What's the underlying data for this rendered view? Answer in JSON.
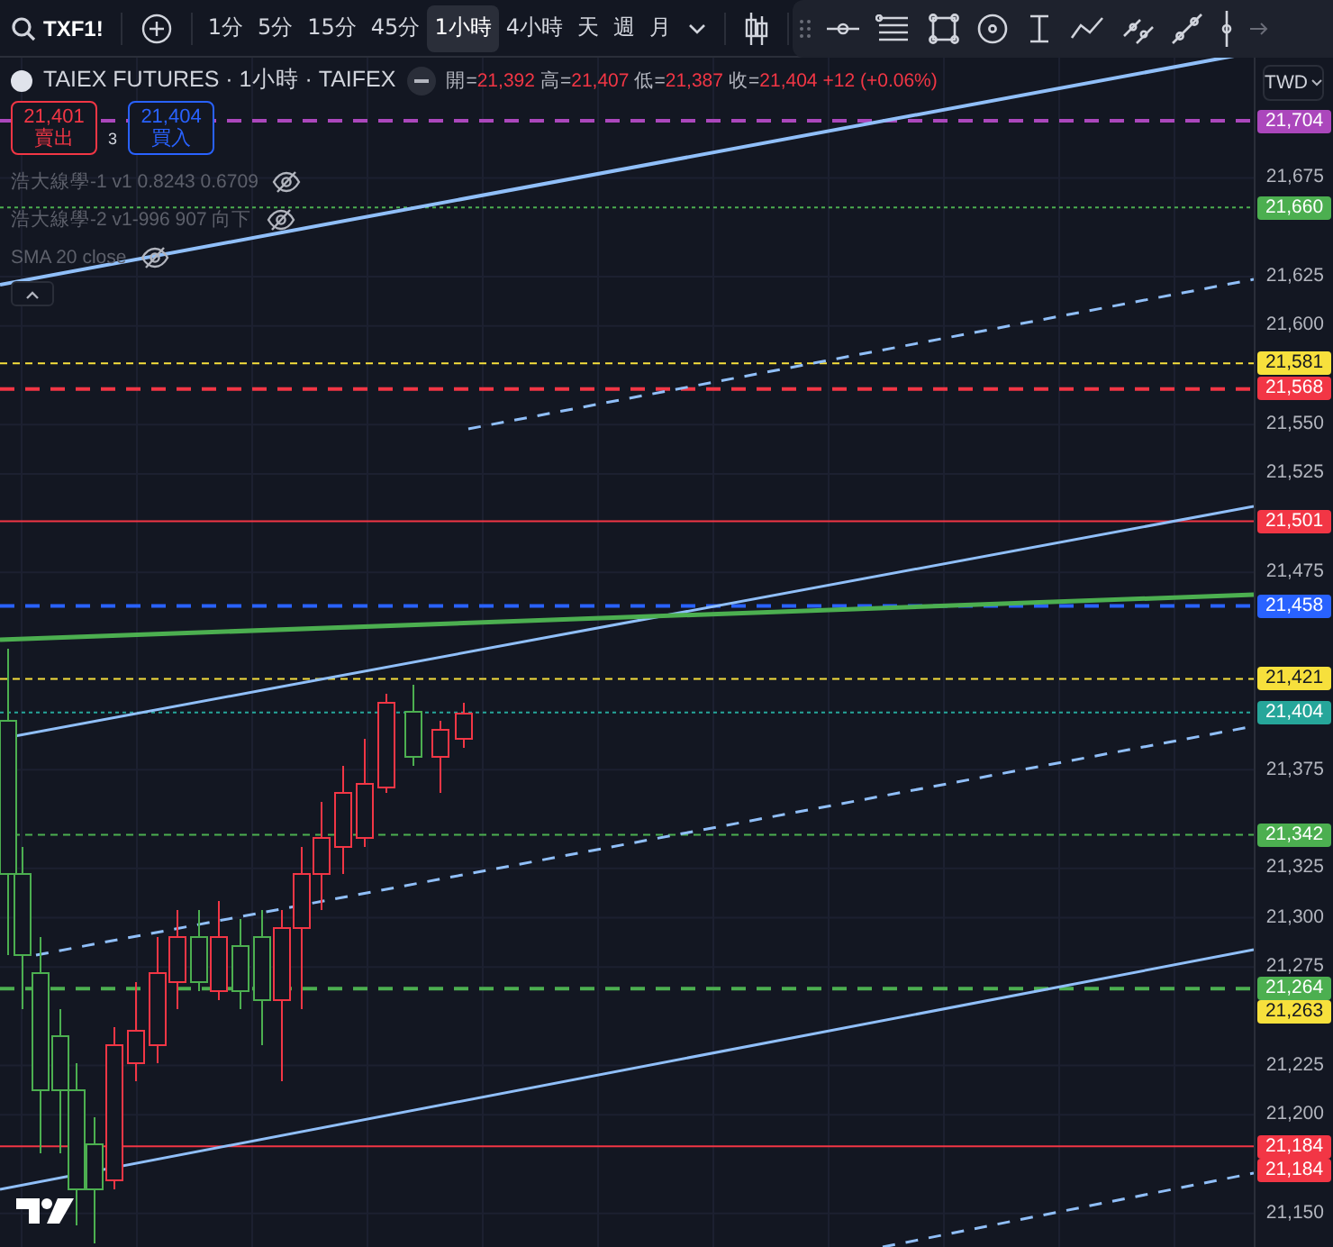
{
  "toolbar": {
    "symbol": "TXF1!",
    "intervals": [
      {
        "label": "1分",
        "selected": false
      },
      {
        "label": "5分",
        "selected": false
      },
      {
        "label": "15分",
        "selected": false
      },
      {
        "label": "45分",
        "selected": false
      },
      {
        "label": "1小時",
        "selected": true
      },
      {
        "label": "4小時",
        "selected": false
      },
      {
        "label": "天",
        "selected": false
      },
      {
        "label": "週",
        "selected": false
      },
      {
        "label": "月",
        "selected": false
      }
    ]
  },
  "legend": {
    "title": "TAIEX FUTURES · 1小時 · TAIFEX",
    "ohlc": [
      {
        "label": "開=",
        "value": "21,392"
      },
      {
        "label": "高=",
        "value": "21,407"
      },
      {
        "label": "低=",
        "value": "21,387"
      },
      {
        "label": "收=",
        "value": "21,404"
      }
    ],
    "change": "+12 (+0.06%)",
    "sell": {
      "price": "21,401",
      "label": "賣出"
    },
    "spread": "3",
    "buy": {
      "price": "21,404",
      "label": "買入"
    },
    "indicators": [
      {
        "name": "浩大線學-1 v1 0.8243 0.6709",
        "visible": false
      },
      {
        "name": "浩大線學-2 v1-996 907 向下",
        "visible": false
      },
      {
        "name": "SMA 20 close",
        "visible": false
      }
    ]
  },
  "price_scale": {
    "currency": "TWD",
    "ticks": [
      "21,675",
      "21,625",
      "21,600",
      "21,550",
      "21,525",
      "21,475",
      "21,375",
      "21,325",
      "21,300",
      "21,275",
      "21,225",
      "21,200",
      "21,150"
    ],
    "markers": [
      {
        "label": "21,704",
        "color": "#ab47bc"
      },
      {
        "label": "21,660",
        "color": "#4caf50"
      },
      {
        "label": "21,581",
        "color": "#f7e03c"
      },
      {
        "label": "21,568",
        "color": "#f23645"
      },
      {
        "label": "21,501",
        "color": "#f23645"
      },
      {
        "label": "21,458",
        "color": "#2962ff"
      },
      {
        "label": "21,421",
        "color": "#f7e03c"
      },
      {
        "label": "21,404",
        "color": "#26a69a"
      },
      {
        "label": "21,342",
        "color": "#4caf50"
      },
      {
        "label": "21,264",
        "color": "#4caf50"
      },
      {
        "label": "21,263",
        "color": "#f7e03c"
      },
      {
        "label": "21,184",
        "color": "#f23645"
      },
      {
        "label": "21,184",
        "color": "#f23645"
      }
    ]
  }
}
